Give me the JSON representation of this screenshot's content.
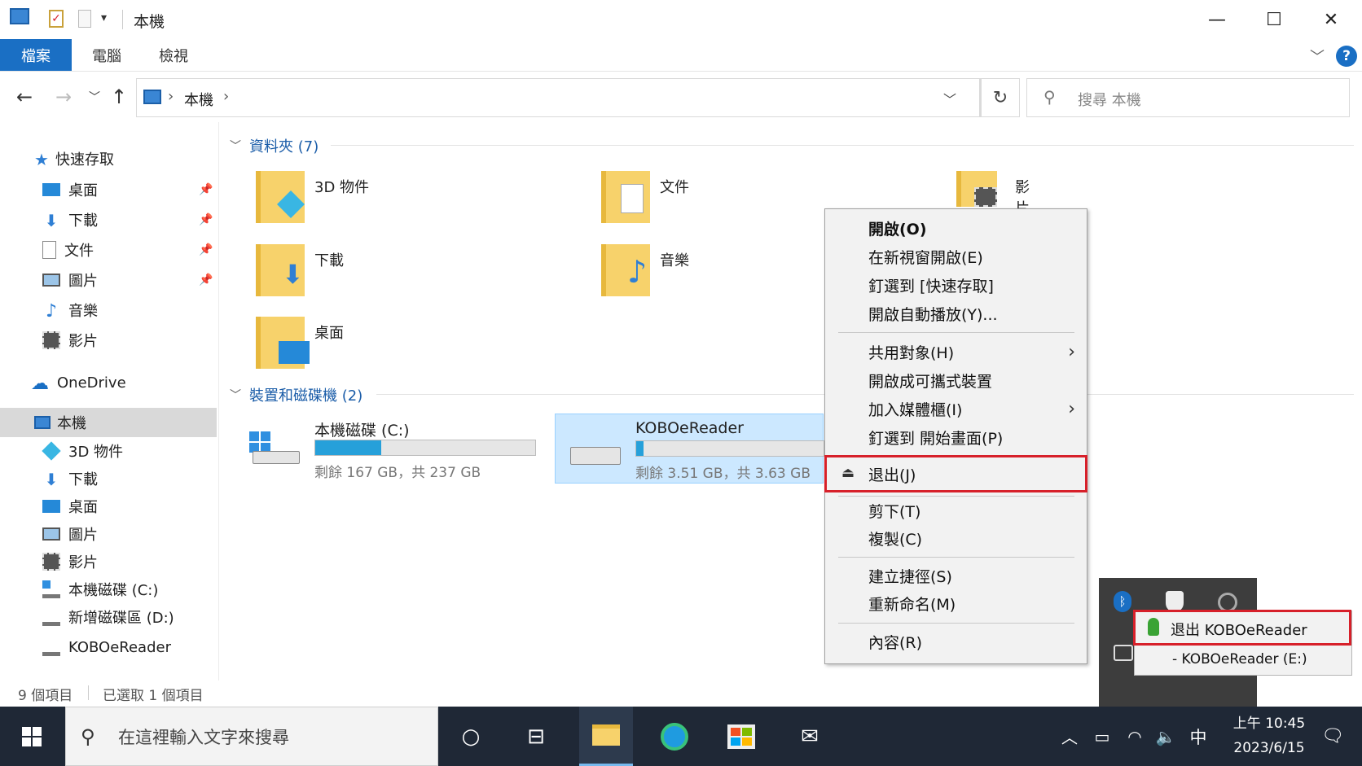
{
  "window": {
    "title": "本機",
    "controls": {
      "minimize": "—",
      "maximize": "☐",
      "close": "✕"
    }
  },
  "ribbon": {
    "tabs": [
      {
        "label": "檔案",
        "active": true
      },
      {
        "label": "電腦",
        "active": false
      },
      {
        "label": "檢視",
        "active": false
      }
    ],
    "help": "?"
  },
  "address": {
    "path": [
      "本機"
    ],
    "search_placeholder": "搜尋 本機"
  },
  "nav_pane": {
    "quick_access_label": "快速存取",
    "quick_access_items": [
      {
        "label": "桌面",
        "pinned": true
      },
      {
        "label": "下載",
        "pinned": true
      },
      {
        "label": "文件",
        "pinned": true
      },
      {
        "label": "圖片",
        "pinned": true
      },
      {
        "label": "音樂",
        "pinned": false
      },
      {
        "label": "影片",
        "pinned": false
      }
    ],
    "onedrive_label": "OneDrive",
    "this_pc_label": "本機",
    "this_pc_items": [
      {
        "label": "3D 物件"
      },
      {
        "label": "下載"
      },
      {
        "label": "桌面"
      },
      {
        "label": "圖片"
      },
      {
        "label": "影片"
      },
      {
        "label": "本機磁碟 (C:)"
      },
      {
        "label": "新增磁碟區 (D:)"
      },
      {
        "label": "KOBOeReader"
      }
    ]
  },
  "content": {
    "folders_header": "資料夾 (7)",
    "folders": [
      {
        "label": "3D 物件"
      },
      {
        "label": "文件"
      },
      {
        "label": "影片"
      },
      {
        "label": "下載"
      },
      {
        "label": "音樂"
      },
      {
        "label": "桌面"
      }
    ],
    "devices_header": "裝置和磁碟機 (2)",
    "drives": [
      {
        "name": "本機磁碟 (C:)",
        "free_text": "剩餘 167 GB，共 237 GB",
        "used_fraction": 0.3
      },
      {
        "name": "KOBOeReader",
        "free_text": "剩餘 3.51 GB，共 3.63 GB",
        "used_fraction": 0.04
      }
    ]
  },
  "status": {
    "item_count": "9 個項目",
    "selected_count": "已選取 1 個項目"
  },
  "context_menu": {
    "items": [
      {
        "label": "開啟(O)"
      },
      {
        "label": "在新視窗開啟(E)"
      },
      {
        "label": "釘選到 [快速存取]"
      },
      {
        "label": "開啟自動播放(Y)..."
      },
      {
        "label": "共用對象(H)"
      },
      {
        "label": "開啟成可攜式裝置"
      },
      {
        "label": "加入媒體櫃(I)"
      },
      {
        "label": "釘選到 開始畫面(P)"
      },
      {
        "label": "退出(J)"
      },
      {
        "label": "剪下(T)"
      },
      {
        "label": "複製(C)"
      },
      {
        "label": "建立捷徑(S)"
      },
      {
        "label": "重新命名(M)"
      },
      {
        "label": "內容(R)"
      }
    ]
  },
  "tray_popup": {
    "eject_label": "退出 KOBOeReader",
    "device_label": "- KOBOeReader (E:)"
  },
  "taskbar": {
    "search_placeholder": "在這裡輸入文字來搜尋",
    "ime": "中",
    "time": "上午 10:45",
    "date": "2023/6/15"
  },
  "colors": {
    "accent": "#1a6fc4",
    "selection": "#cce8ff",
    "drive_fill": "#26a0da",
    "highlight_red": "#d7202a",
    "taskbar": "#1f2836"
  }
}
